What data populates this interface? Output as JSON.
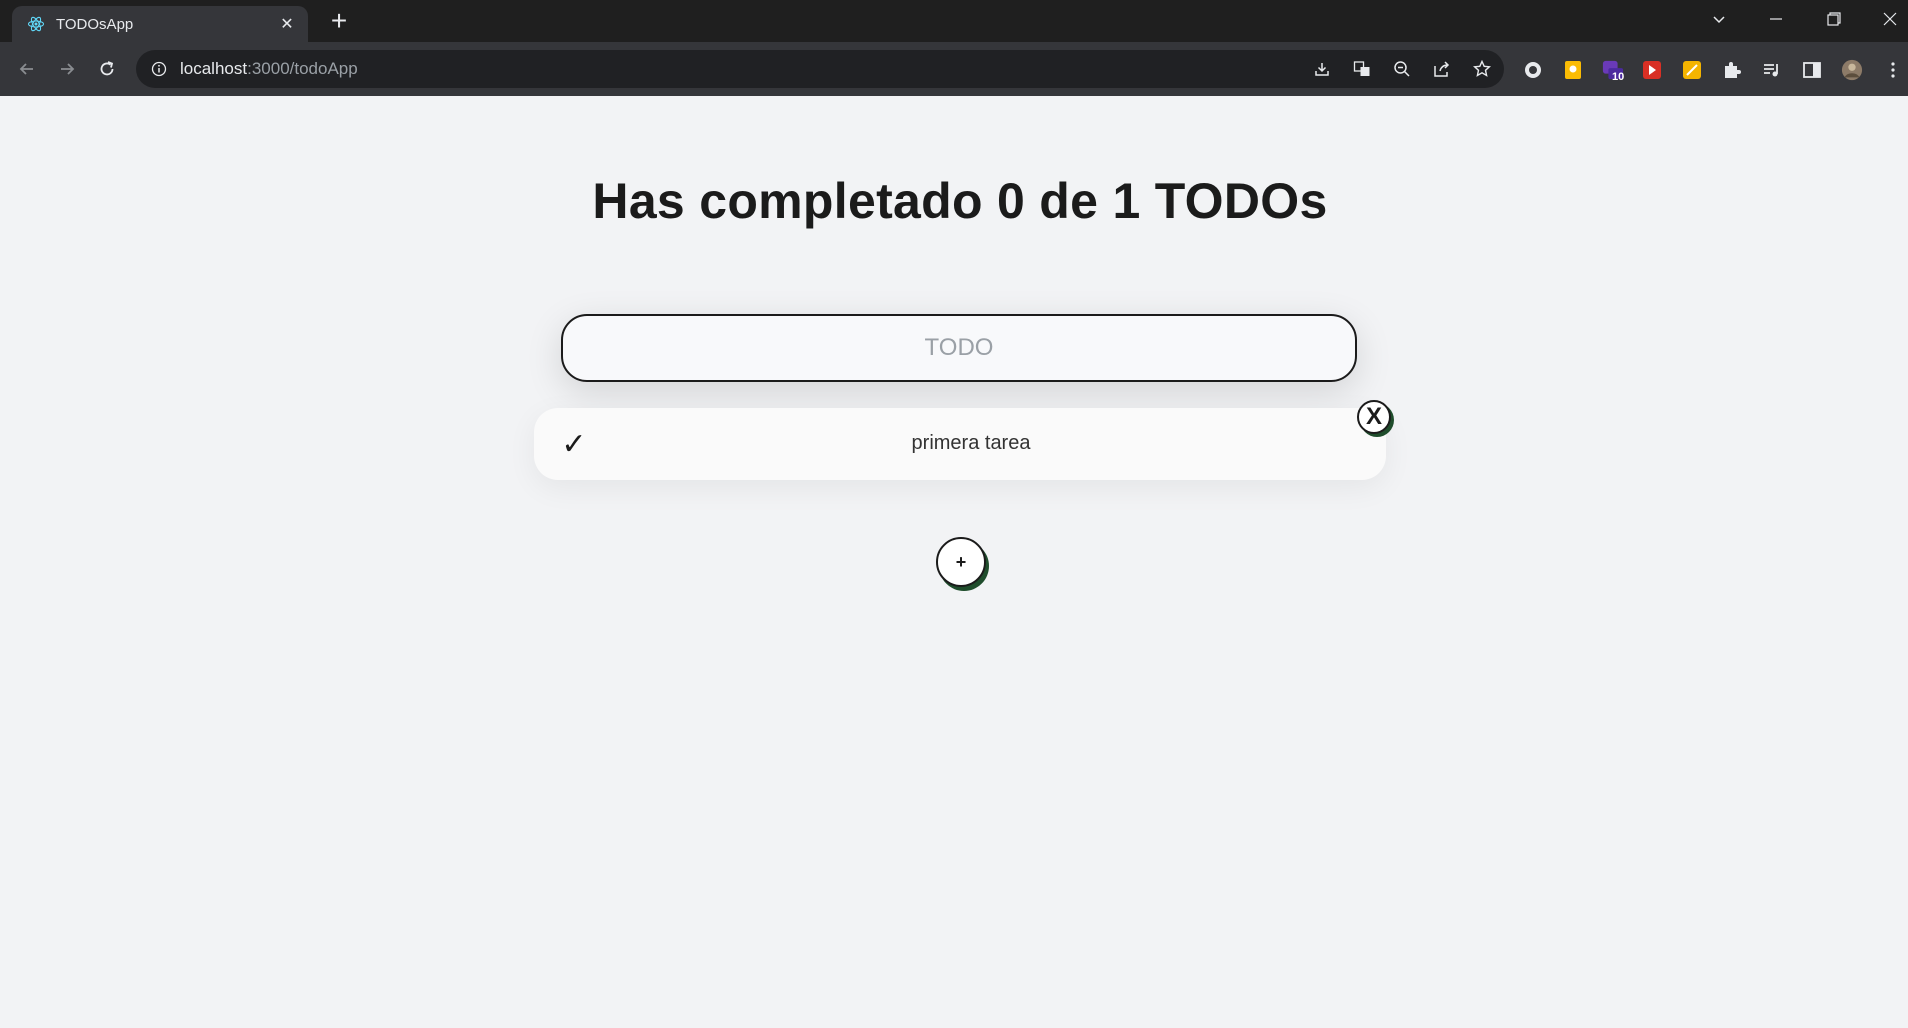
{
  "browser": {
    "tab_title": "TODOsApp",
    "tab_close": "✕",
    "new_tab": "+",
    "url_host": "localhost",
    "url_rest": ":3000/todoApp",
    "extension_badge": "10"
  },
  "app": {
    "heading": "Has completado 0 de 1 TODOs",
    "input": {
      "placeholder": "TODO",
      "value": ""
    },
    "todos": [
      {
        "text": "primera tarea",
        "completed": false,
        "check": "✓",
        "delete": "X"
      }
    ],
    "add_button": "+"
  },
  "colors": {
    "page_bg": "#f2f3f5",
    "accent_shadow": "#1f4d2c",
    "text": "#1b1b1b"
  }
}
